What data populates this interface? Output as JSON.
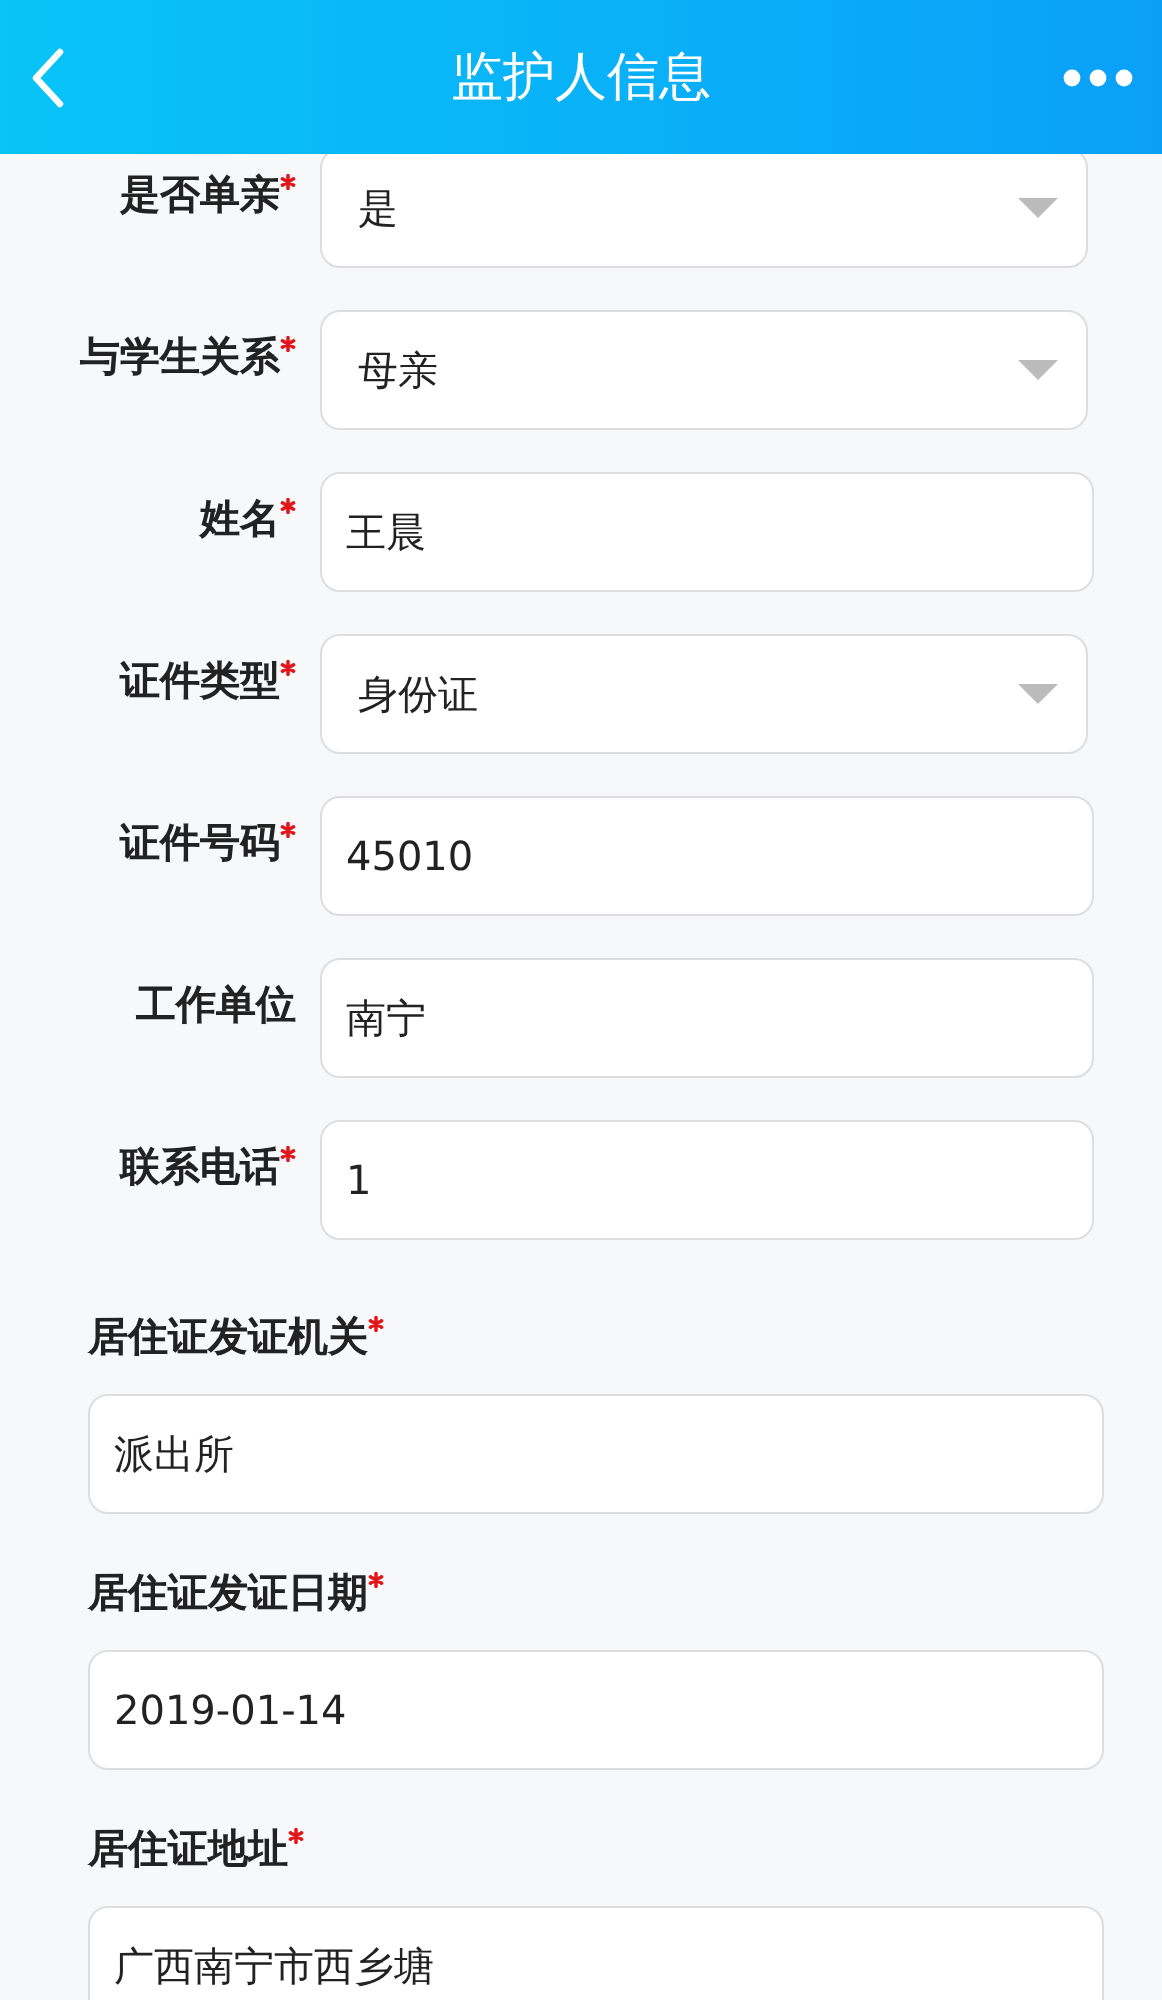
{
  "header": {
    "title": "监护人信息"
  },
  "inline_fields": [
    {
      "label": "是否单亲",
      "required": true,
      "kind": "select",
      "value": "是"
    },
    {
      "label": "与学生关系",
      "required": true,
      "kind": "select",
      "value": "母亲"
    },
    {
      "label": "姓名",
      "required": true,
      "kind": "text",
      "value": "王晨"
    },
    {
      "label": "证件类型",
      "required": true,
      "kind": "select",
      "value": "身份证"
    },
    {
      "label": "证件号码",
      "required": true,
      "kind": "text",
      "value": "45010"
    },
    {
      "label": "工作单位",
      "required": false,
      "kind": "text",
      "value": "南宁"
    },
    {
      "label": "联系电话",
      "required": true,
      "kind": "text",
      "value": "1"
    }
  ],
  "stacked_fields": [
    {
      "label": "居住证发证机关",
      "required": true,
      "value": "派出所"
    },
    {
      "label": "居住证发证日期",
      "required": true,
      "value": "2019-01-14"
    },
    {
      "label": "居住证地址",
      "required": true,
      "value": "广西南宁市西乡塘"
    }
  ]
}
